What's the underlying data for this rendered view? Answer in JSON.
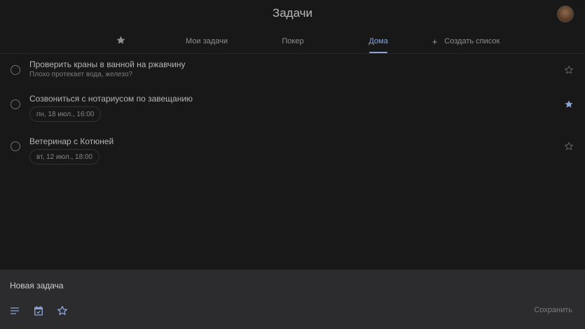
{
  "app": {
    "title": "Задачи"
  },
  "tabs": [
    {
      "label": "Мои задачи"
    },
    {
      "label": "Покер"
    },
    {
      "label": "Дома"
    }
  ],
  "create_list": {
    "label": "Создать список"
  },
  "tasks": [
    {
      "title": "Проверить краны в ванной на ржавчину",
      "notes": "Плохо протекает вода, железо?",
      "starred": false
    },
    {
      "title": "Созвониться с нотариусом по завещанию",
      "due": "пн, 18 июл., 16:00",
      "starred": true
    },
    {
      "title": "Ветеринар с Котюней",
      "due": "вт, 12 июл., 18:00",
      "starred": false
    }
  ],
  "composer": {
    "placeholder": "Новая задача",
    "save_label": "Сохранить"
  },
  "colors": {
    "accent": "#8ba3d6",
    "background": "#181818",
    "composer_bg": "#2c2c2e"
  },
  "icons": [
    "star-icon",
    "plus-icon",
    "details-icon",
    "calendar-icon",
    "avatar"
  ]
}
